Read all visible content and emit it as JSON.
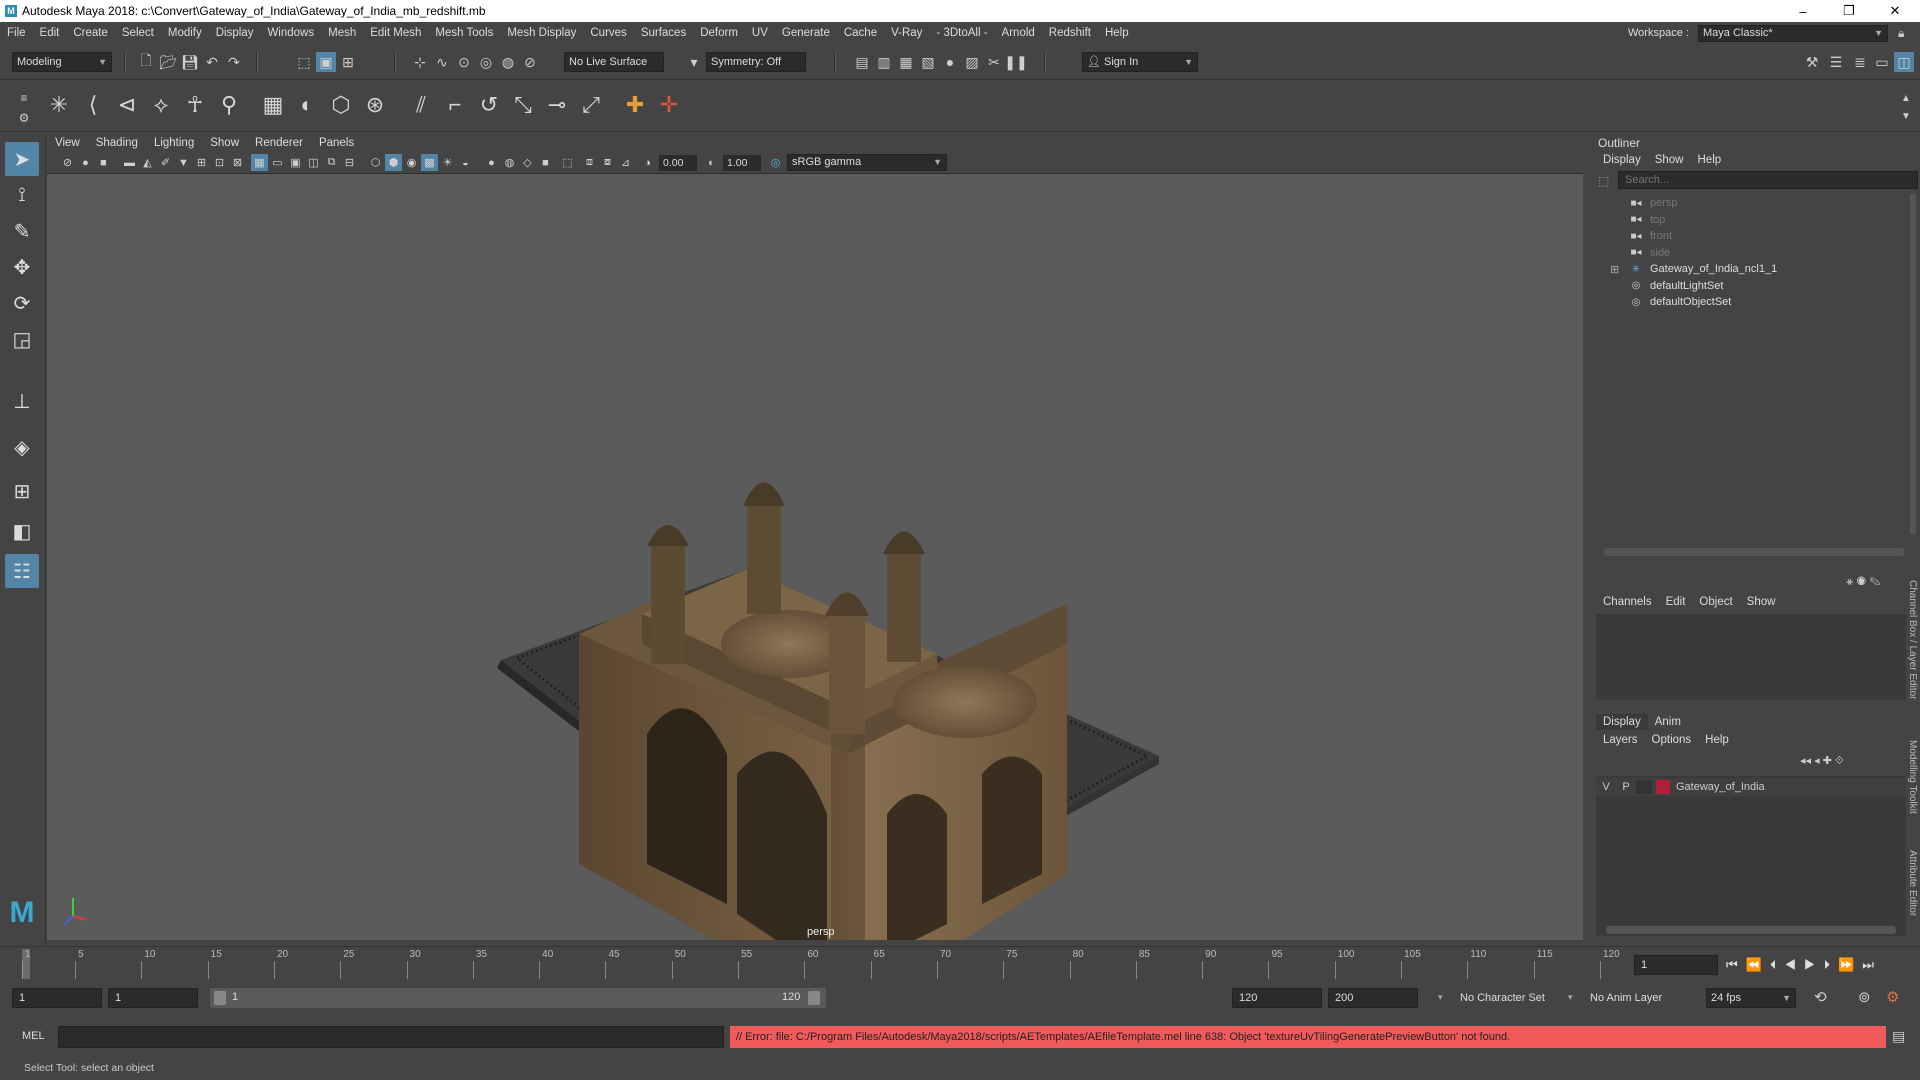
{
  "window": {
    "title": "Autodesk Maya 2018: c:\\Convert\\Gateway_of_India\\Gateway_of_India_mb_redshift.mb",
    "minimize": "–",
    "maximize": "❐",
    "close": "✕"
  },
  "menubar": {
    "items": [
      "File",
      "Edit",
      "Create",
      "Select",
      "Modify",
      "Display",
      "Windows",
      "Mesh",
      "Edit Mesh",
      "Mesh Tools",
      "Mesh Display",
      "Curves",
      "Surfaces",
      "Deform",
      "UV",
      "Generate",
      "Cache",
      "V-Ray",
      "- 3DtoAll -",
      "Arnold",
      "Redshift",
      "Help"
    ],
    "workspace_label": "Workspace :",
    "workspace_value": "Maya Classic*"
  },
  "status_line": {
    "mode": "Modeling",
    "live_surface": "No Live Surface",
    "symmetry": "Symmetry: Off",
    "sign_in": "Sign In"
  },
  "viewport": {
    "menus": [
      "View",
      "Shading",
      "Lighting",
      "Show",
      "Renderer",
      "Panels"
    ],
    "exposure": "0.00",
    "gamma": "1.00",
    "color_space": "sRGB gamma",
    "camera_label": "persp"
  },
  "outliner": {
    "title": "Outliner",
    "menus": [
      "Display",
      "Show",
      "Help"
    ],
    "search_placeholder": "Search...",
    "items": [
      {
        "label": "persp",
        "icon": "camera-icon",
        "dim": true
      },
      {
        "label": "top",
        "icon": "camera-icon",
        "dim": true
      },
      {
        "label": "front",
        "icon": "camera-icon",
        "dim": true
      },
      {
        "label": "side",
        "icon": "camera-icon",
        "dim": true
      },
      {
        "label": "Gateway_of_India_ncl1_1",
        "icon": "group-icon",
        "dim": false
      },
      {
        "label": "defaultLightSet",
        "icon": "set-icon",
        "dim": false
      },
      {
        "label": "defaultObjectSet",
        "icon": "set-icon",
        "dim": false
      }
    ],
    "expand": "⊞"
  },
  "channel_box": {
    "menus": [
      "Channels",
      "Edit",
      "Object",
      "Show"
    ]
  },
  "layer_editor": {
    "tabs": [
      "Display",
      "Anim"
    ],
    "menus": [
      "Layers",
      "Options",
      "Help"
    ],
    "layer": {
      "v": "V",
      "p": "P",
      "name": "Gateway_of_India",
      "color": "#b0203a"
    }
  },
  "side_tabs": [
    "Channel Box / Layer Editor",
    "Modelling Toolkit",
    "Attribute Editor"
  ],
  "timeline": {
    "ticks": [
      "1",
      "5",
      "10",
      "15",
      "20",
      "25",
      "30",
      "35",
      "40",
      "45",
      "50",
      "55",
      "60",
      "65",
      "70",
      "75",
      "80",
      "85",
      "90",
      "95",
      "100",
      "105",
      "110",
      "115",
      "120"
    ],
    "current_frame": "1"
  },
  "range": {
    "start": "1",
    "playback_start": "1",
    "slider_start": "1",
    "slider_end": "120",
    "playback_end": "120",
    "end": "200",
    "character_set": "No Character Set",
    "anim_layer": "No Anim Layer",
    "fps": "24 fps"
  },
  "command_line": {
    "lang": "MEL",
    "error": "// Error: file: C:/Program Files/Autodesk/Maya2018/scripts/AETemplates/AEfileTemplate.mel line 638: Object 'textureUvTilingGeneratePreviewButton' not found.",
    "error_color": "#f05a5a"
  },
  "help_line": "Select Tool: select an object"
}
